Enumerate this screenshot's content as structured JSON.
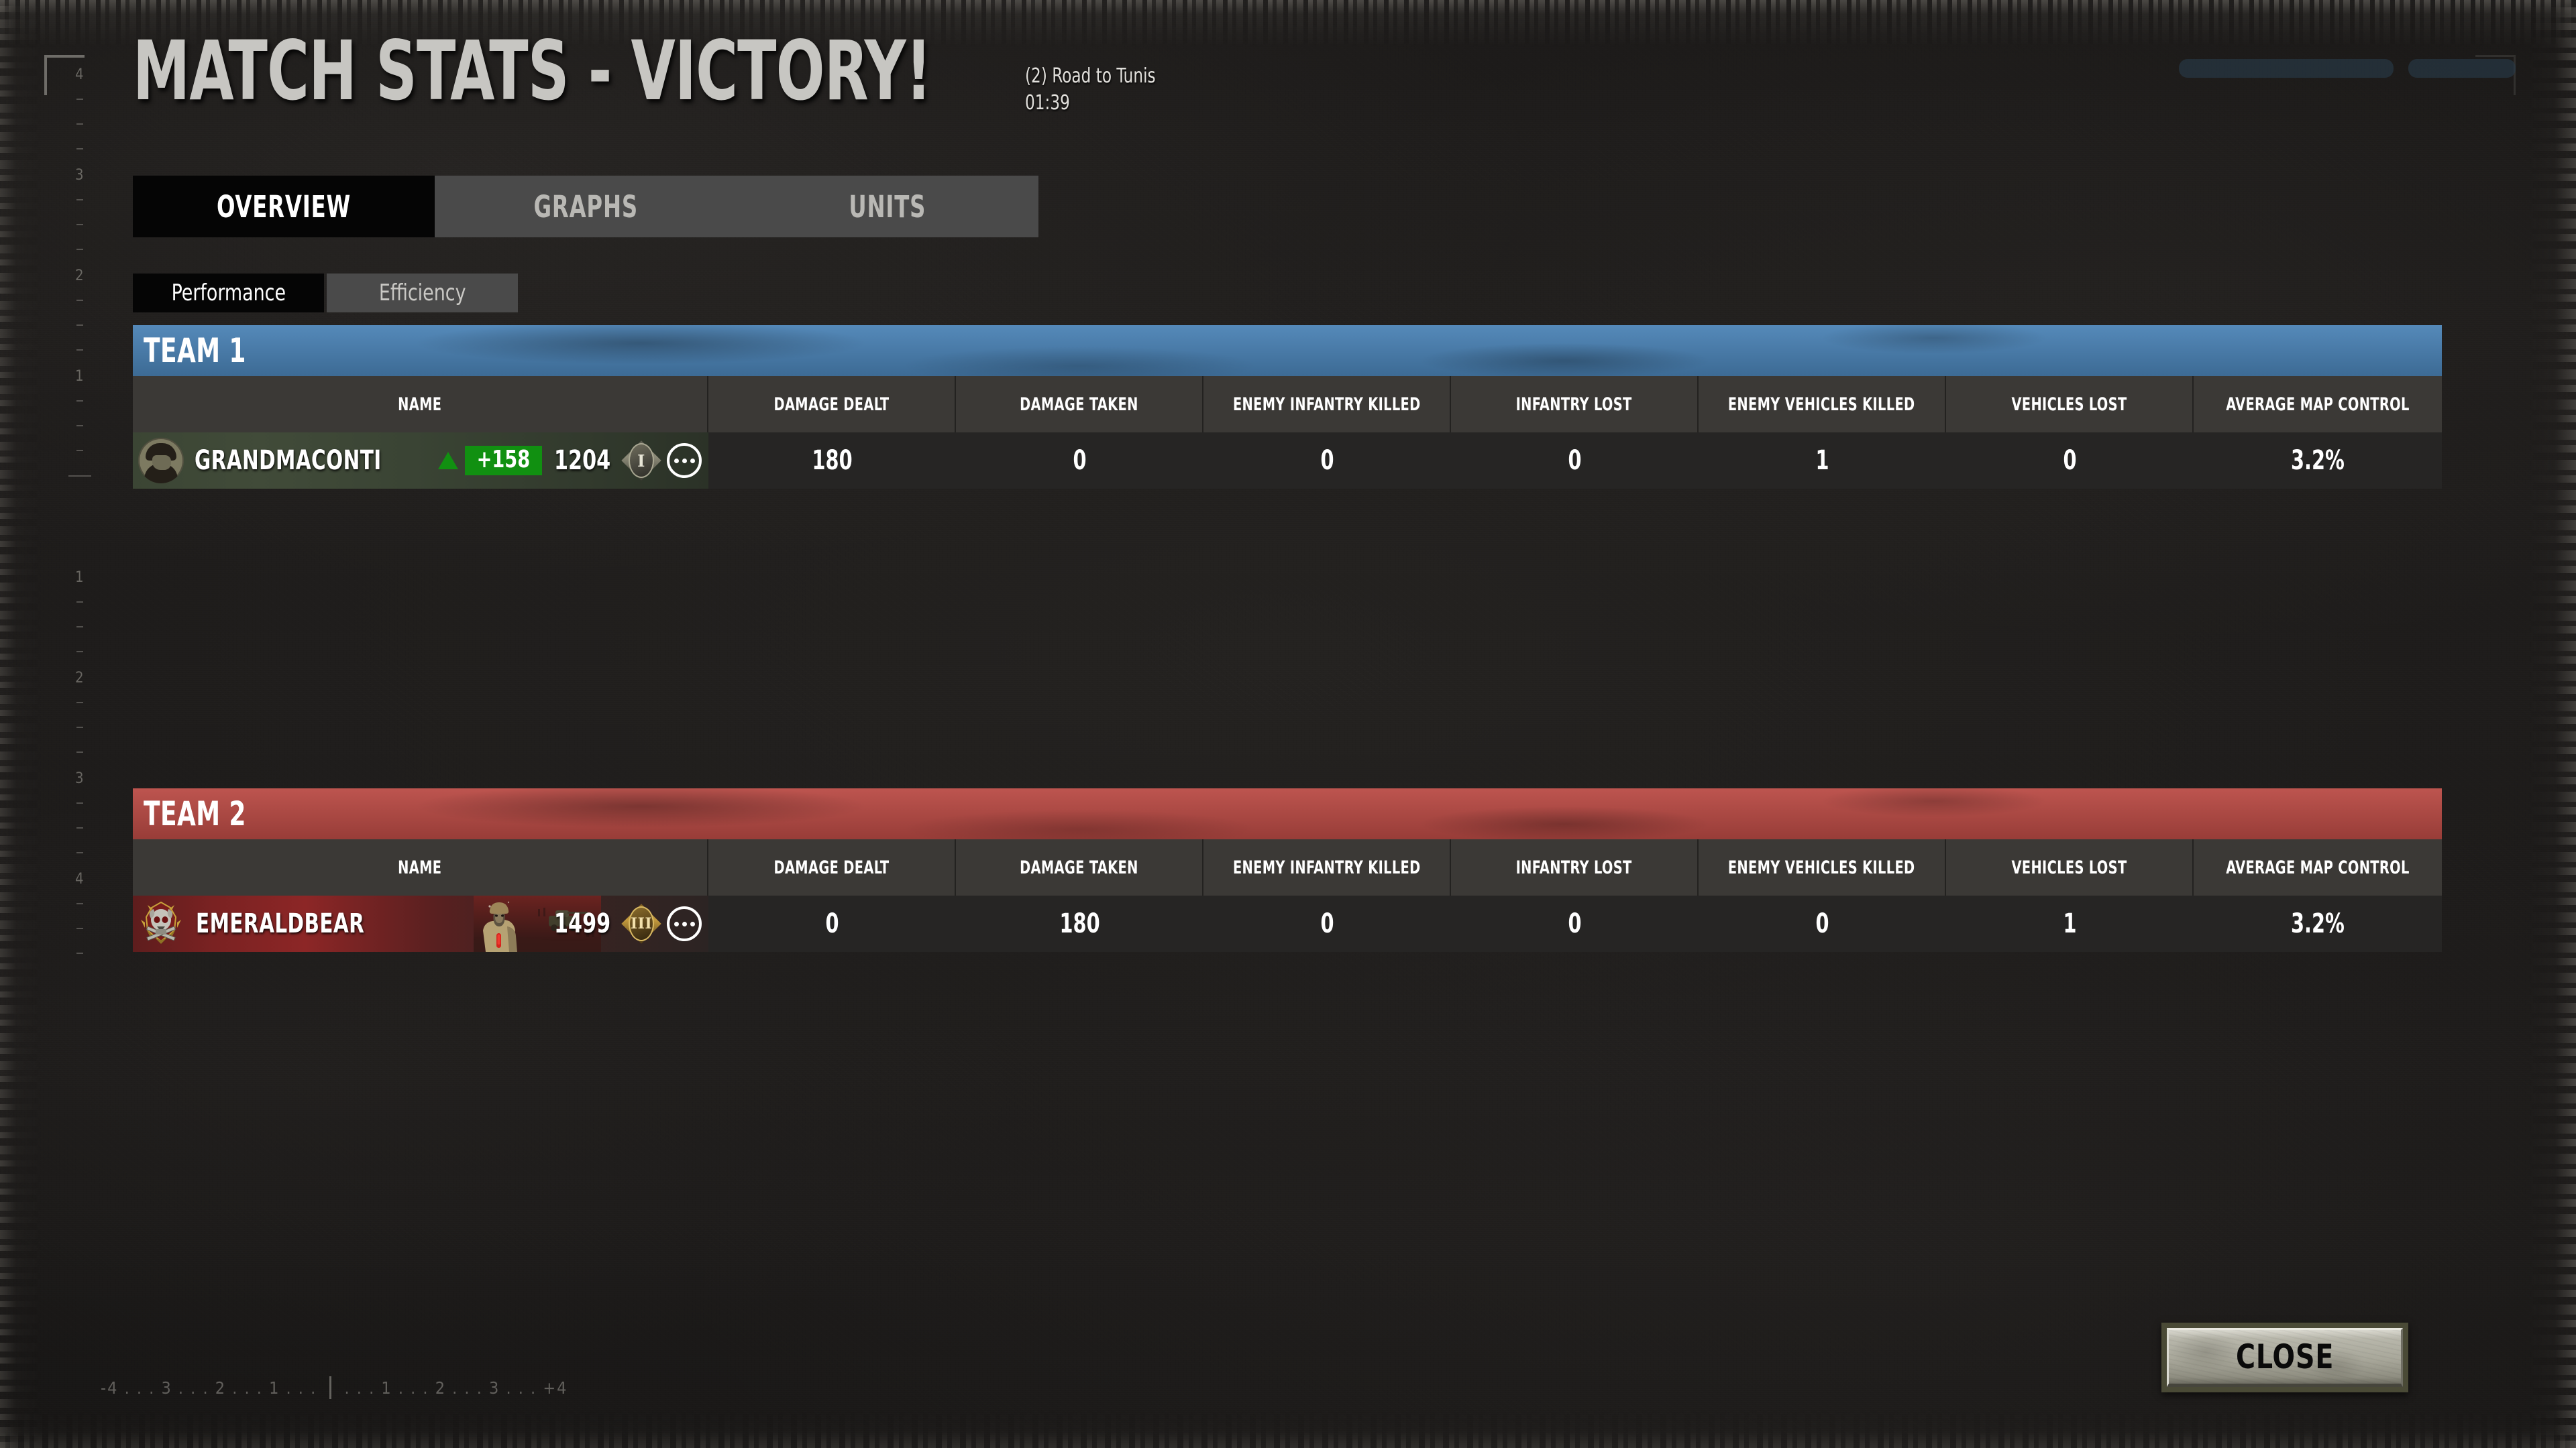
{
  "header": {
    "title": "MATCH STATS - VICTORY!",
    "map_name": "(2) Road to Tunis",
    "match_time": "01:39"
  },
  "main_tabs": [
    {
      "label": "OVERVIEW",
      "active": true
    },
    {
      "label": "GRAPHS",
      "active": false
    },
    {
      "label": "UNITS",
      "active": false
    }
  ],
  "sub_tabs": [
    {
      "label": "Performance",
      "active": true
    },
    {
      "label": "Efficiency",
      "active": false
    }
  ],
  "columns": [
    "NAME",
    "DAMAGE DEALT",
    "DAMAGE TAKEN",
    "ENEMY INFANTRY KILLED",
    "INFANTRY LOST",
    "ENEMY VEHICLES KILLED",
    "VEHICLES LOST",
    "AVERAGE MAP CONTROL"
  ],
  "teams": [
    {
      "name": "TEAM 1",
      "color": "#4a82b5",
      "players": [
        {
          "name": "GRANDMACONTI",
          "rating_trend": "up",
          "rating_delta": "+158",
          "rating": "1204",
          "rank": "I",
          "more_label": "...",
          "stats": [
            "180",
            "0",
            "0",
            "0",
            "1",
            "0",
            "3.2%"
          ]
        }
      ]
    },
    {
      "name": "TEAM 2",
      "color": "#b94a44",
      "players": [
        {
          "name": "EMERALDBEAR",
          "rating_trend": "none",
          "rating_delta": "",
          "rating": "1499",
          "rank": "III",
          "more_label": "...",
          "stats": [
            "0",
            "180",
            "0",
            "0",
            "0",
            "1",
            "3.2%"
          ]
        }
      ]
    }
  ],
  "footer": {
    "close_label": "CLOSE"
  },
  "rulers": {
    "horizontal_left": [
      "4",
      "3",
      "2",
      "1"
    ],
    "horizontal_right": [
      "1",
      "2",
      "3",
      "4"
    ],
    "horizontal_minus": "-",
    "horizontal_plus": "+",
    "vertical": [
      "4",
      "3",
      "2",
      "1",
      "1",
      "2",
      "3",
      "4"
    ]
  },
  "colors": {
    "team1": "#4a82b5",
    "team2": "#b94a44",
    "positive": "#119011",
    "header_row": "#3b3936",
    "data_row": "#262524",
    "tab_active": "#050505",
    "tab_inactive": "#4a4a4a"
  }
}
